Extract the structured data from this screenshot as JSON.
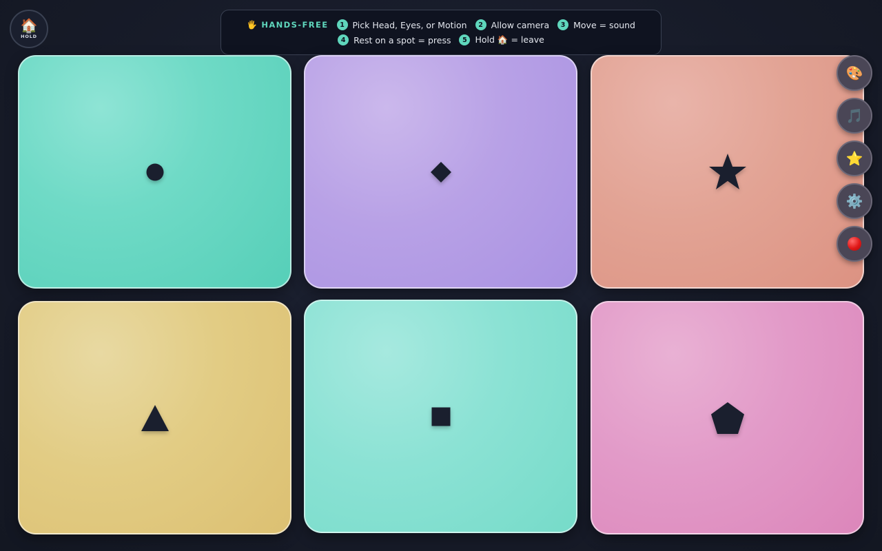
{
  "home": {
    "icon": "🏠",
    "label": "HOLD"
  },
  "instructions": {
    "title_icon": "🖐",
    "title": "HANDS-FREE",
    "steps": [
      {
        "num": "1",
        "text": "Pick Head, Eyes, or Motion"
      },
      {
        "num": "2",
        "text": "Allow camera"
      },
      {
        "num": "3",
        "text": "Move = sound"
      },
      {
        "num": "4",
        "text": "Rest on a spot = press"
      },
      {
        "num": "5",
        "text_before": "Hold",
        "icon": "🏠",
        "text_after": "= leave"
      }
    ]
  },
  "tiles": [
    {
      "shape": "circle-icon",
      "color": "#6fdac6"
    },
    {
      "shape": "diamond-icon",
      "color": "#b8a1e6"
    },
    {
      "shape": "star-icon",
      "color": "#e2a394"
    },
    {
      "shape": "triangle-icon",
      "color": "#e2cc84"
    },
    {
      "shape": "square-icon",
      "color": "#8be2d4"
    },
    {
      "shape": "pentagon-icon",
      "color": "#e29ac8"
    }
  ],
  "toolbar": [
    {
      "icon": "🎨",
      "name": "palette-icon"
    },
    {
      "icon": "🎵",
      "name": "music-note-icon"
    },
    {
      "icon": "⭐",
      "name": "star-icon"
    },
    {
      "icon": "⚙️",
      "name": "gear-icon"
    },
    {
      "icon": "",
      "name": "record-icon"
    }
  ],
  "colors": {
    "accent": "#5fd6bc",
    "shape": "#1a1f2e",
    "background": "#181d2b"
  }
}
